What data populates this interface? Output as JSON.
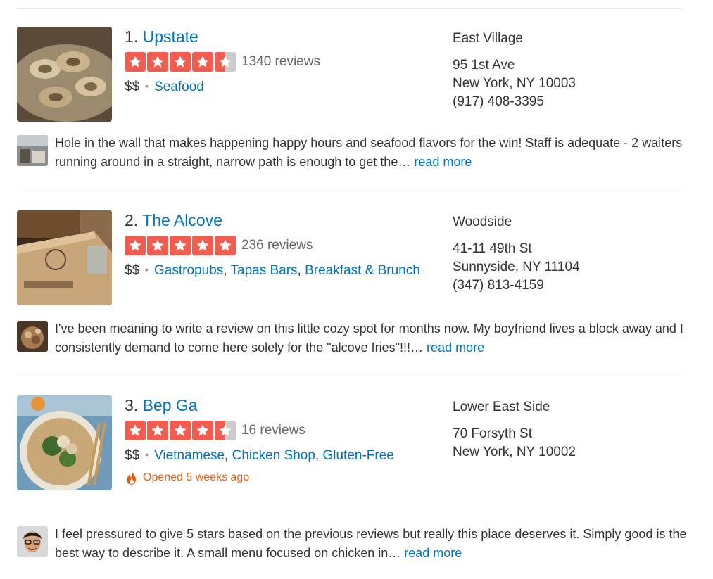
{
  "results": [
    {
      "rank": "1.",
      "name": "Upstate",
      "rating": 4.5,
      "review_count": "1340 reviews",
      "price": "$$",
      "categories": [
        "Seafood"
      ],
      "neighborhood": "East Village",
      "address_line1": "95 1st Ave",
      "address_line2": "New York, NY 10003",
      "phone": "(917) 408-3395",
      "snippet": "Hole in the wall that makes happening happy hours and seafood flavors for the win!  Staff is adequate - 2 waiters running around in a straight, narrow path is enough to get the…",
      "read_more": "read more"
    },
    {
      "rank": "2.",
      "name": "The Alcove",
      "rating": 5,
      "review_count": "236 reviews",
      "price": "$$",
      "categories": [
        "Gastropubs",
        "Tapas Bars",
        "Breakfast & Brunch"
      ],
      "neighborhood": "Woodside",
      "address_line1": "41-11 49th St",
      "address_line2": "Sunnyside, NY 11104",
      "phone": "(347) 813-4159",
      "snippet": "I've been meaning to write a review on this little cozy spot for months now. My boyfriend lives a block away and I consistently demand to come here solely for the \"alcove fries\"!!!…",
      "read_more": "read more"
    },
    {
      "rank": "3.",
      "name": "Bep Ga",
      "rating": 4.5,
      "review_count": "16 reviews",
      "price": "$$",
      "categories": [
        "Vietnamese",
        "Chicken Shop",
        "Gluten-Free"
      ],
      "opened": "Opened 5 weeks ago",
      "neighborhood": "Lower East Side",
      "address_line1": "70 Forsyth St",
      "address_line2": "New York, NY 10002",
      "snippet": "I feel pressured to give 5 stars based on the previous reviews but really this place deserves it.   Simply good is the best way to describe it. A small menu focused on chicken in…",
      "read_more": "read more"
    }
  ],
  "icons": {
    "star": "star-icon",
    "opened": "flame-icon"
  },
  "colors": {
    "link": "#0073bb",
    "star": "#f15c4f",
    "star_empty": "#cccccc",
    "opened": "#e05e16"
  }
}
